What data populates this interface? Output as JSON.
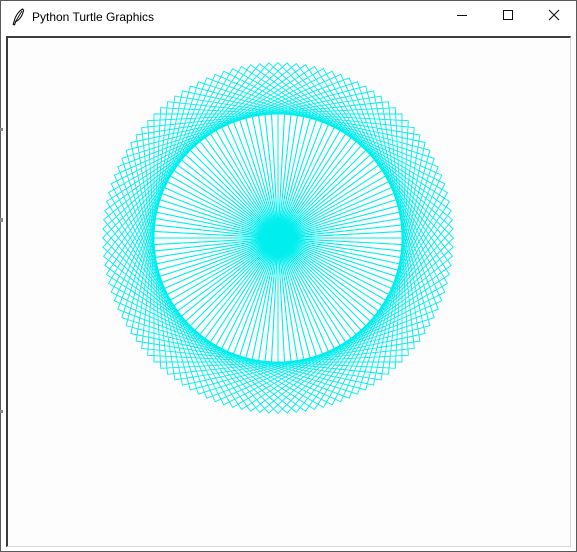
{
  "window": {
    "title": "Python Turtle Graphics",
    "app_icon": "feather-icon"
  },
  "controls": {
    "minimize": "minimize-icon",
    "maximize": "maximize-icon",
    "close": "close-icon"
  },
  "drawing": {
    "pen_color": "#00eeee",
    "background_color": "#fdfdfd",
    "shape": "square",
    "squares": 120,
    "turn_degrees": 3
  }
}
